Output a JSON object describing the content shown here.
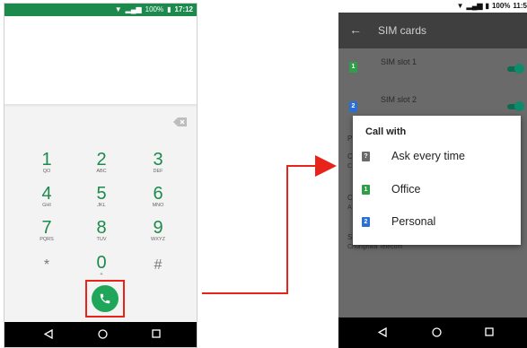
{
  "left_phone": {
    "status": {
      "battery": "100%",
      "time": "17:12"
    },
    "keys": [
      {
        "digit": "1",
        "letters": "QO"
      },
      {
        "digit": "2",
        "letters": "ABC"
      },
      {
        "digit": "3",
        "letters": "DEF"
      },
      {
        "digit": "4",
        "letters": "GHI"
      },
      {
        "digit": "5",
        "letters": "JKL"
      },
      {
        "digit": "6",
        "letters": "MNO"
      },
      {
        "digit": "7",
        "letters": "PQRS"
      },
      {
        "digit": "8",
        "letters": "TUV"
      },
      {
        "digit": "9",
        "letters": "WXYZ"
      },
      {
        "digit": "*",
        "letters": ""
      },
      {
        "digit": "0",
        "letters": "+"
      },
      {
        "digit": "#",
        "letters": ""
      }
    ]
  },
  "right_phone": {
    "status": {
      "battery": "100%",
      "time": "11:5"
    },
    "appbar": {
      "title": "SIM cards"
    },
    "sim_slots": [
      {
        "label": "SIM slot 1",
        "badge": "1"
      },
      {
        "label": "SIM slot 2",
        "badge": "2"
      }
    ],
    "background_rows": [
      {
        "letter": "P"
      },
      {
        "letter": "C",
        "sub": "C"
      },
      {
        "letter": "C",
        "sub": "A"
      },
      {
        "letter": "S",
        "sub": "Chunghwa Telecom"
      }
    ],
    "dialog": {
      "title": "Call with",
      "options": [
        {
          "label": "Ask every time",
          "badge": "?"
        },
        {
          "label": "Office",
          "badge": "1"
        },
        {
          "label": "Personal",
          "badge": "2"
        }
      ]
    }
  },
  "colors": {
    "accent_green": "#1b8a4c",
    "call_green": "#1fa65a",
    "highlight_red": "#e8231a",
    "sim1_green": "#2e9e48",
    "sim2_blue": "#2a6fd6",
    "ask_gray": "#6a6a6a"
  }
}
